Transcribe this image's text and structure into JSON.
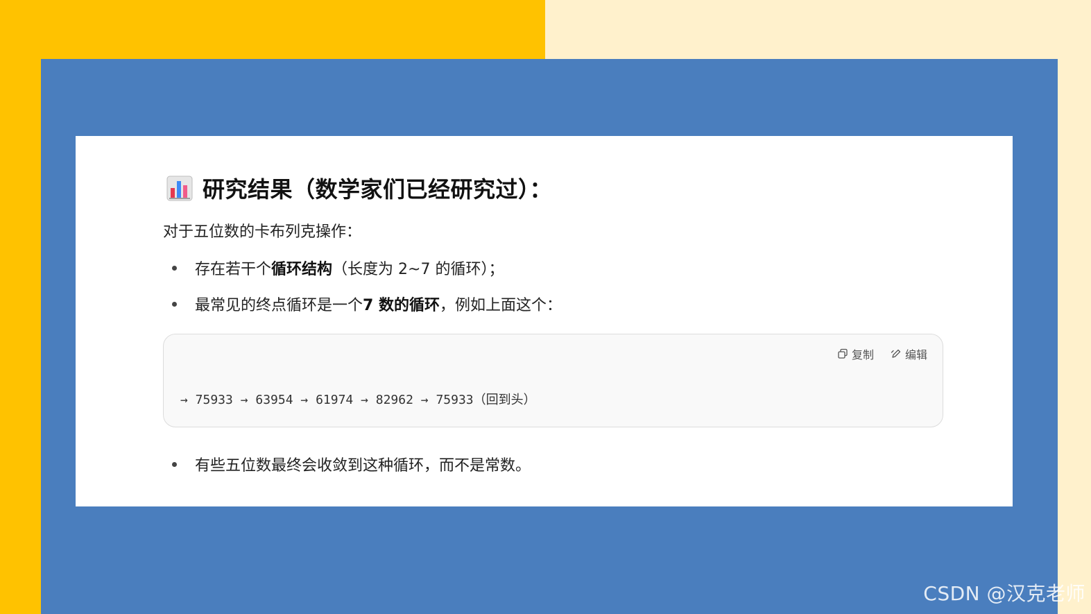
{
  "heading": {
    "icon": "bar-chart-icon",
    "text": "研究结果（数学家们已经研究过）："
  },
  "intro": "对于五位数的卡布列克操作：",
  "bullets": [
    {
      "prefix": "存在若干个",
      "bold": "循环结构",
      "suffix": "（长度为 2~7 的循环）；"
    },
    {
      "prefix": "最常见的终点循环是一个 ",
      "bold": "7 数的循环",
      "suffix": "，例如上面这个："
    },
    {
      "text": "有些五位数最终会收敛到这种循环，而不是常数。"
    }
  ],
  "code_block": {
    "copy_label": "复制",
    "edit_label": "编辑",
    "line": "→ 75933 → 63954 → 61974 → 82962 → 75933（回到头）"
  },
  "watermark": "CSDN @汉克老师",
  "colors": {
    "yellow": "#FFC200",
    "cream": "#FFF1CC",
    "blue": "#4A7EBE",
    "card": "#FFFFFF"
  }
}
